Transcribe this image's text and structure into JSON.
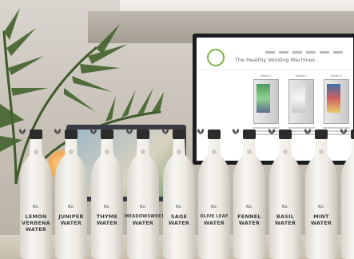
{
  "monitor": {
    "title": "The Healthy Vending Machines",
    "machines": [
      "Model 1",
      "Model 2",
      "Model 3"
    ]
  },
  "bottles": [
    {
      "line1": "LEMON",
      "line2": "VERBENA",
      "line3": "WATER"
    },
    {
      "line1": "JUNIPER",
      "line2": "WATER",
      "line3": ""
    },
    {
      "line1": "THYME",
      "line2": "WATER",
      "line3": ""
    },
    {
      "line1": "MEADOWSWEET",
      "line2": "WATER",
      "line3": ""
    },
    {
      "line1": "SAGE",
      "line2": "WATER",
      "line3": ""
    },
    {
      "line1": "OLIVE LEAF",
      "line2": "WATER",
      "line3": ""
    },
    {
      "line1": "FENNEL",
      "line2": "WATER",
      "line3": ""
    },
    {
      "line1": "BASIL",
      "line2": "WATER",
      "line3": ""
    },
    {
      "line1": "MINT",
      "line2": "WATER",
      "line3": ""
    },
    {
      "line1": "R",
      "line2": "",
      "line3": ""
    }
  ],
  "bottle_mark": "No.",
  "colors": {
    "bottle": "#f1efe9",
    "cap": "#2c2c2c",
    "label_text": "#3d3d3d",
    "accent_green": "#7cb342"
  }
}
